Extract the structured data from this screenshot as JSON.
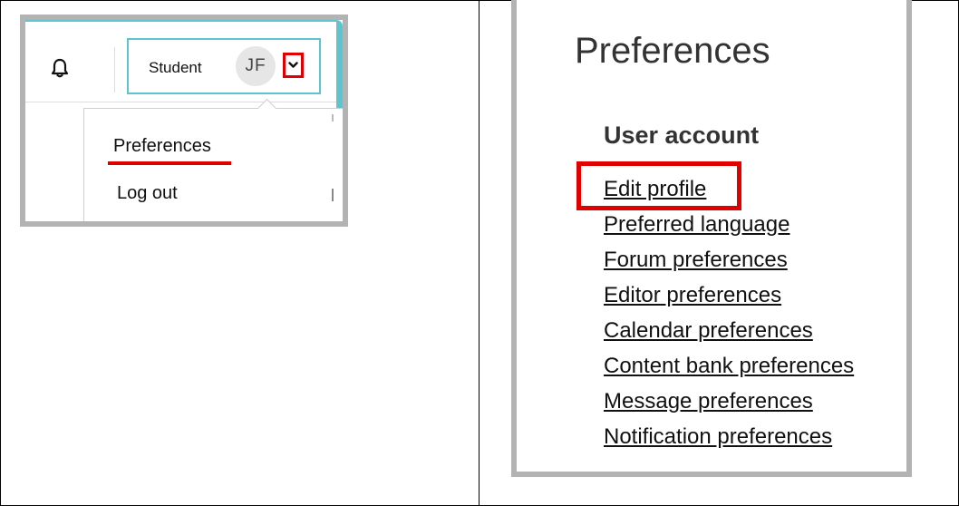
{
  "header": {
    "user_name": "Student",
    "avatar_initials": "JF",
    "icons": [
      "bell-icon",
      "chevron-down-icon"
    ]
  },
  "user_menu": {
    "items": [
      {
        "label": "Preferences"
      },
      {
        "label": "Log out"
      }
    ]
  },
  "preferences_page": {
    "title": "Preferences",
    "section": "User account",
    "links": [
      {
        "label": "Edit profile"
      },
      {
        "label": "Preferred language"
      },
      {
        "label": "Forum preferences"
      },
      {
        "label": "Editor preferences"
      },
      {
        "label": "Calendar preferences"
      },
      {
        "label": "Content bank preferences"
      },
      {
        "label": "Message preferences"
      },
      {
        "label": "Notification preferences"
      }
    ]
  },
  "colors": {
    "highlight": "#e00000",
    "accent": "#5ec5ce",
    "screenshot_border": "#b3b3b3"
  }
}
